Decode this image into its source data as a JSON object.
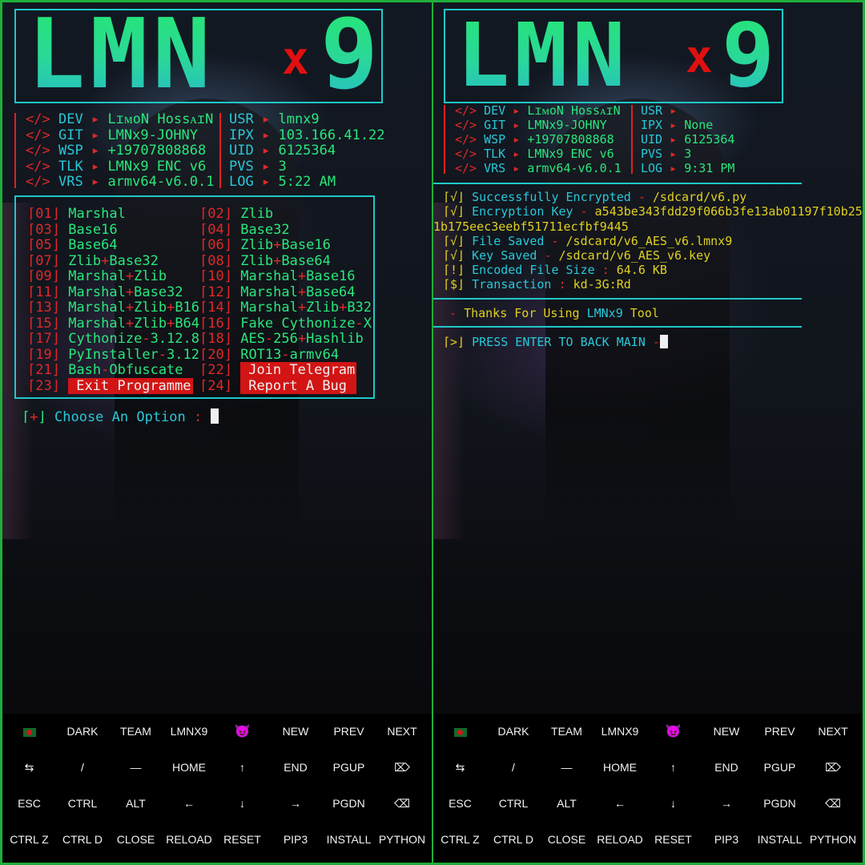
{
  "logo": {
    "left_text": "LMN",
    "x_char": "x",
    "right_text": "9"
  },
  "left": {
    "info_left": [
      {
        "tag": "</>",
        "key": "DEV",
        "arrow": "▸",
        "value": "LɪᴍoN HossᴀɪN"
      },
      {
        "tag": "</>",
        "key": "GIT",
        "arrow": "▸",
        "value": "LMNx9-JOHNY"
      },
      {
        "tag": "</>",
        "key": "WSP",
        "arrow": "▸",
        "value": "+19707808868"
      },
      {
        "tag": "</>",
        "key": "TLK",
        "arrow": "▸",
        "value": "LMNx9 ENC v6"
      },
      {
        "tag": "</>",
        "key": "VRS",
        "arrow": "▸",
        "value": "armv64-v6.0.1"
      }
    ],
    "info_right": [
      {
        "key": "USR",
        "arrow": "▸",
        "value": "lmnx9"
      },
      {
        "key": "IPX",
        "arrow": "▸",
        "value": "103.166.41.22"
      },
      {
        "key": "UID",
        "arrow": "▸",
        "value": "6125364"
      },
      {
        "key": "PVS",
        "arrow": "▸",
        "value": "3"
      },
      {
        "key": "LOG",
        "arrow": "▸",
        "value": "5:22 AM"
      }
    ],
    "menu": [
      {
        "num": "⌈01⌋",
        "parts": [
          "Marshal"
        ]
      },
      {
        "num": "⌈02⌋",
        "parts": [
          "Zlib"
        ]
      },
      {
        "num": "⌈03⌋",
        "parts": [
          "Base16"
        ]
      },
      {
        "num": "⌈04⌋",
        "parts": [
          "Base32"
        ]
      },
      {
        "num": "⌈05⌋",
        "parts": [
          "Base64"
        ]
      },
      {
        "num": "⌈06⌋",
        "parts": [
          "Zlib",
          "+",
          "Base16"
        ]
      },
      {
        "num": "⌈07⌋",
        "parts": [
          "Zlib",
          "+",
          "Base32"
        ]
      },
      {
        "num": "⌈08⌋",
        "parts": [
          "Zlib",
          "+",
          "Base64"
        ]
      },
      {
        "num": "⌈09⌋",
        "parts": [
          "Marshal",
          "+",
          "Zlib"
        ]
      },
      {
        "num": "⌈10⌋",
        "parts": [
          "Marshal",
          "+",
          "Base16"
        ]
      },
      {
        "num": "⌈11⌋",
        "parts": [
          "Marshal",
          "+",
          "Base32"
        ]
      },
      {
        "num": "⌈12⌋",
        "parts": [
          "Marshal",
          "+",
          "Base64"
        ]
      },
      {
        "num": "⌈13⌋",
        "parts": [
          "Marshal",
          "+",
          "Zlib",
          "+",
          "B16"
        ]
      },
      {
        "num": "⌈14⌋",
        "parts": [
          "Marshal",
          "+",
          "Zlib",
          "+",
          "B32"
        ]
      },
      {
        "num": "⌈15⌋",
        "parts": [
          "Marshal",
          "+",
          "Zlib",
          "+",
          "B64"
        ]
      },
      {
        "num": "⌈16⌋",
        "parts": [
          "Fake Cythonize",
          "-",
          "X"
        ]
      },
      {
        "num": "⌈17⌋",
        "parts": [
          "Cythonize",
          "-",
          "3.12.8"
        ]
      },
      {
        "num": "⌈18⌋",
        "parts": [
          "AES",
          "-",
          "256",
          "+",
          "Hashlib"
        ]
      },
      {
        "num": "⌈19⌋",
        "parts": [
          "PyInstaller",
          "-",
          "3.12"
        ]
      },
      {
        "num": "⌈20⌋",
        "parts": [
          "ROT13",
          "-",
          "armv64"
        ]
      },
      {
        "num": "⌈21⌋",
        "parts": [
          "Bash",
          "-",
          "Obfuscate"
        ]
      },
      {
        "num": "⌈22⌋",
        "parts": [
          "Join Telegram"
        ],
        "highlight": true
      },
      {
        "num": "⌈23⌋",
        "parts": [
          "Exit Programme"
        ],
        "highlight": true
      },
      {
        "num": "⌈24⌋",
        "parts": [
          "Report A Bug"
        ],
        "highlight": true
      }
    ],
    "prompt": {
      "bracket_open": "⌈",
      "symbol": "+",
      "bracket_close": "⌋",
      "text": "Choose An Option",
      "colon": ":"
    }
  },
  "right": {
    "info_left": [
      {
        "tag": "</>",
        "key": "DEV",
        "arrow": "▸",
        "value": "LɪᴍoN HossᴀɪN"
      },
      {
        "tag": "</>",
        "key": "GIT",
        "arrow": "▸",
        "value": "LMNx9-JOHNY"
      },
      {
        "tag": "</>",
        "key": "WSP",
        "arrow": "▸",
        "value": "+19707808868"
      },
      {
        "tag": "</>",
        "key": "TLK",
        "arrow": "▸",
        "value": "LMNx9 ENC v6"
      },
      {
        "tag": "</>",
        "key": "VRS",
        "arrow": "▸",
        "value": "armv64-v6.0.1"
      }
    ],
    "info_right": [
      {
        "key": "USR",
        "arrow": "▸",
        "value": ""
      },
      {
        "key": "IPX",
        "arrow": "▸",
        "value": "None"
      },
      {
        "key": "UID",
        "arrow": "▸",
        "value": "6125364"
      },
      {
        "key": "PVS",
        "arrow": "▸",
        "value": "3"
      },
      {
        "key": "LOG",
        "arrow": "▸",
        "value": "9:31 PM"
      }
    ],
    "log": [
      {
        "tag": "⌈√⌋",
        "label": "Successfully Encrypted",
        "dash": "-",
        "value": "/sdcard/v6.py"
      },
      {
        "tag": "⌈√⌋",
        "label": "Encryption Key",
        "dash": "-",
        "value": "a543be343fdd29f066b3fe13ab01197f10b25"
      },
      {
        "tag": "",
        "label": "",
        "dash": "",
        "value": "1b175eec3eebf51711ecfbf9445"
      },
      {
        "tag": "⌈√⌋",
        "label": "File Saved",
        "dash": "-",
        "value": "/sdcard/v6_AES_v6.lmnx9"
      },
      {
        "tag": "⌈√⌋",
        "label": "Key Saved",
        "dash": "-",
        "value": "/sdcard/v6_AES_v6.key"
      },
      {
        "tag": "⌈!⌋",
        "label": "Encoded File Size",
        "dash": ":",
        "value": "64.6 KB"
      },
      {
        "tag": "⌈$⌋",
        "label": "Transaction",
        "dash": ":",
        "value": "kd-3G:Rd"
      }
    ],
    "thanks": {
      "dash": "-",
      "pre": "Thanks For Using",
      "brand": "LMNx9",
      "post": "Tool"
    },
    "press": {
      "tag": "⌈>⌋",
      "text": "PRESS ENTER TO BACK MAIN",
      "dash": "-"
    }
  },
  "keyboard": [
    [
      "🇧🇩",
      "DARK",
      "TEAM",
      "LMNX9",
      "😈",
      "NEW",
      "PREV",
      "NEXT"
    ],
    [
      "⇆",
      "/",
      "—",
      "HOME",
      "↑",
      "END",
      "PGUP",
      "⌦"
    ],
    [
      "ESC",
      "CTRL",
      "ALT",
      "←",
      "↓",
      "→",
      "PGDN",
      "⌫"
    ],
    [
      "CTRL Z",
      "CTRL D",
      "CLOSE",
      "RELOAD",
      "RESET",
      "PIP3",
      "INSTALL",
      "PYTHON"
    ]
  ],
  "colors": {
    "accent": "#1ec8c8",
    "green": "#29e67c",
    "red": "#e02828",
    "highlight": "#d21414",
    "frame": "#1fae3a"
  }
}
